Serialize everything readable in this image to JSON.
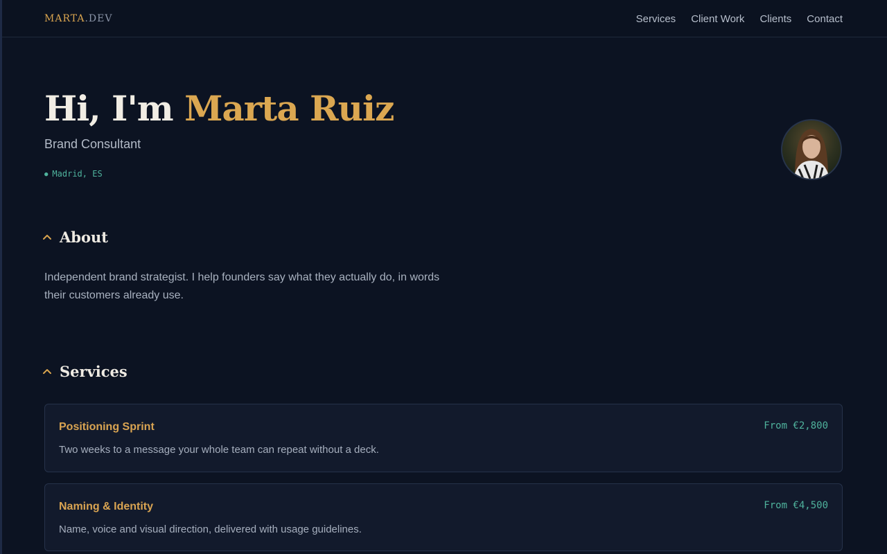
{
  "nav": {
    "logo_main": "MARTA",
    "logo_suffix": ".DEV",
    "links": [
      "Services",
      "Client Work",
      "Clients",
      "Contact"
    ]
  },
  "hero": {
    "greeting": "Hi, I'm ",
    "name": "Marta Ruiz",
    "subtitle": "Brand Consultant",
    "location": "Madrid, ES"
  },
  "about": {
    "title": "About",
    "text": "Independent brand strategist. I help founders say what they actually do, in words their customers already use."
  },
  "services": {
    "title": "Services",
    "items": [
      {
        "title": "Positioning Sprint",
        "price": "From €2,800",
        "description": "Two weeks to a message your whole team can repeat without a deck."
      },
      {
        "title": "Naming & Identity",
        "price": "From €4,500",
        "description": "Name, voice and visual direction, delivered with usage guidelines."
      }
    ]
  },
  "colors": {
    "background": "#0c1322",
    "accent": "#d9a44f",
    "teal": "#4fb39d"
  }
}
